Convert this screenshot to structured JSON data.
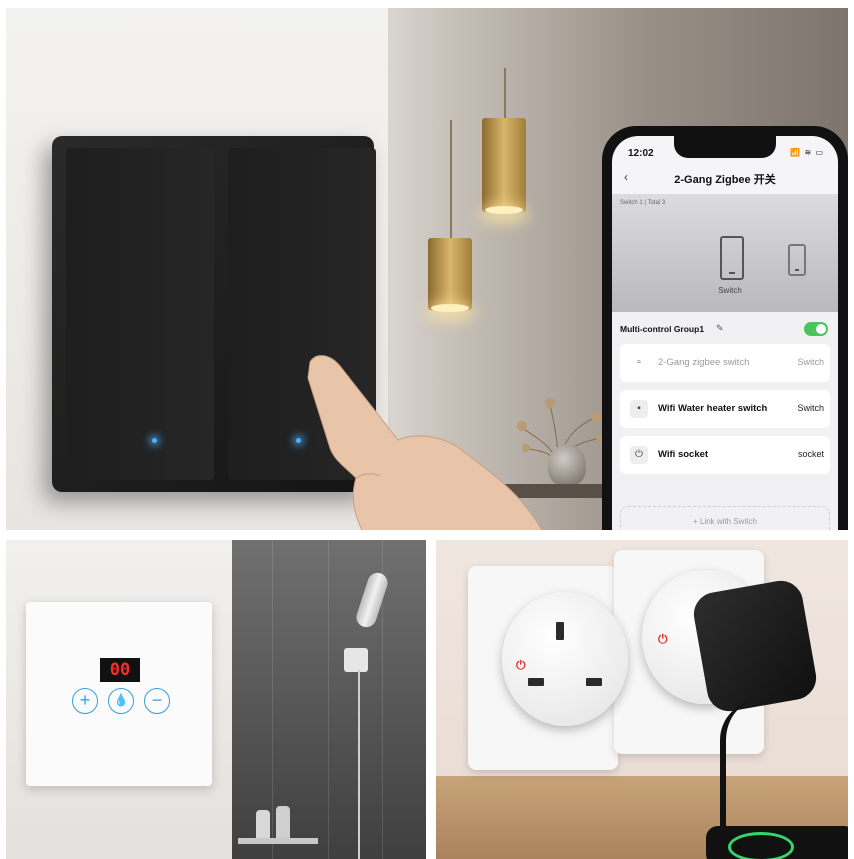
{
  "phone": {
    "status_time": "12:02",
    "status_icons": "📶 ≋ ▭",
    "title": "2-Gang Zigbee 开关",
    "subtitle": "Switch 1 | Total 3",
    "selected_device_label": "Switch",
    "group": {
      "name": "Multi-control Group1",
      "enabled": true
    },
    "devices": [
      {
        "name": "2-Gang zigbee switch",
        "type": "Switch",
        "active": false
      },
      {
        "name": "Wifi Water heater switch",
        "type": "Switch",
        "active": true
      },
      {
        "name": "Wifi socket",
        "type": "socket",
        "active": true
      }
    ],
    "link_button": "+   Link with Switch",
    "accent_color": "#49c55b"
  },
  "thermostat": {
    "display": "00",
    "buttons": [
      "+",
      "💧",
      "−"
    ],
    "accent_color": "#3a9ddf",
    "display_color": "#ff2a2a"
  },
  "icons": [
    "back-arrow-icon",
    "pencil-icon",
    "toggle-icon",
    "power-icon",
    "water-drop-icon",
    "plus-icon",
    "minus-icon"
  ]
}
